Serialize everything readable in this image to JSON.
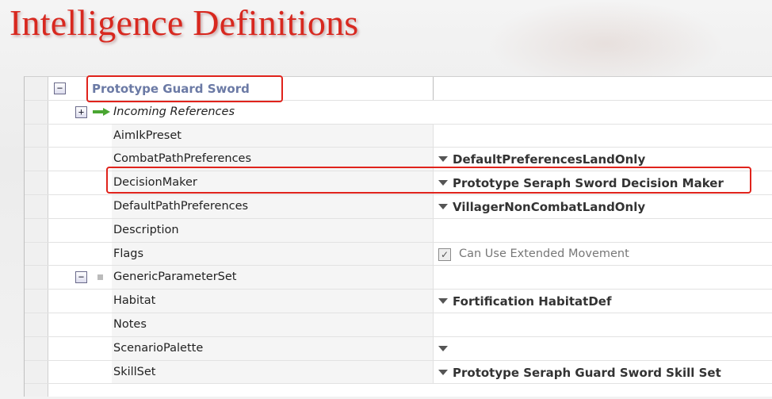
{
  "slide": {
    "title": "Intelligence Definitions"
  },
  "grid": {
    "title_item": "Prototype Guard Sword",
    "incoming_references": "Incoming References",
    "rows": [
      {
        "name": "AimIkPreset",
        "value": ""
      },
      {
        "name": "CombatPathPreferences",
        "value": "DefaultPreferencesLandOnly"
      },
      {
        "name": "DecisionMaker",
        "value": "Prototype Seraph Sword Decision Maker"
      },
      {
        "name": "DefaultPathPreferences",
        "value": "VillagerNonCombatLandOnly"
      },
      {
        "name": "Description",
        "value": ""
      },
      {
        "name": "Flags",
        "value": "Can Use Extended Movement",
        "checked": true
      }
    ],
    "generic_parameter_set": "GenericParameterSet",
    "sub_rows": [
      {
        "name": "Habitat",
        "value": "Fortification HabitatDef"
      },
      {
        "name": "Notes",
        "value": ""
      },
      {
        "name": "ScenarioPalette",
        "value": ""
      },
      {
        "name": "SkillSet",
        "value": "Prototype Seraph Guard Sword Skill Set"
      }
    ]
  },
  "icons": {
    "collapse": "minus-box-icon",
    "expand": "plus-box-icon",
    "reference_arrow": "green-arrow-icon",
    "dropdown": "dropdown-arrow-icon"
  },
  "colors": {
    "title_red": "#d8281f",
    "highlight_red": "#e0231c",
    "title_item_blue": "#6b7aa5",
    "arrow_green": "#4aa632"
  }
}
